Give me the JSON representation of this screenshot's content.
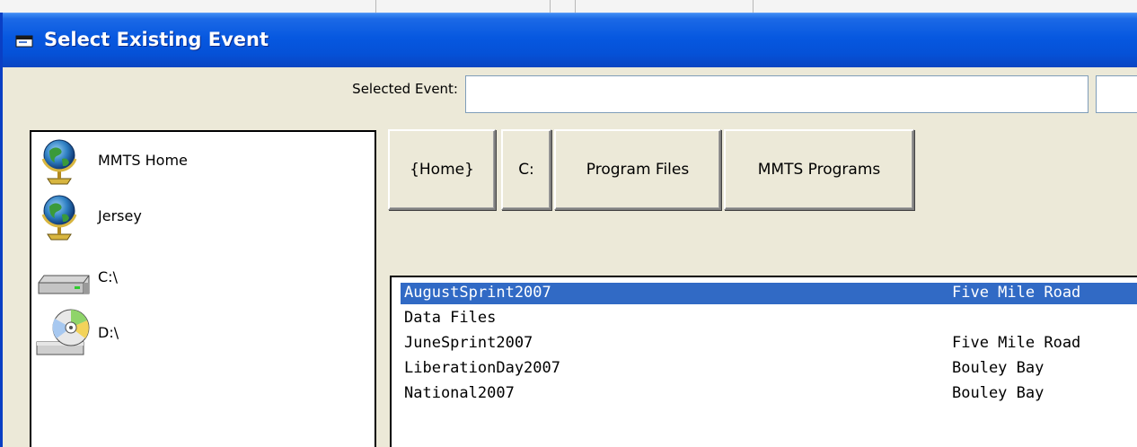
{
  "window": {
    "title": "Select Existing Event"
  },
  "selected_event": {
    "label": "Selected Event:",
    "value": ""
  },
  "drives": [
    {
      "label": "MMTS Home",
      "icon": "globe-icon"
    },
    {
      "label": "Jersey",
      "icon": "globe-icon"
    },
    {
      "label": "C:\\",
      "icon": "hard-drive-icon"
    },
    {
      "label": "D:\\",
      "icon": "cd-drive-icon"
    }
  ],
  "breadcrumbs": [
    {
      "label": "{Home}"
    },
    {
      "label": "C:"
    },
    {
      "label": "Program Files"
    },
    {
      "label": "MMTS Programs"
    }
  ],
  "events": {
    "selected_index": 0,
    "rows": [
      {
        "name": "AugustSprint2007",
        "location": "Five Mile Road"
      },
      {
        "name": "Data Files",
        "location": ""
      },
      {
        "name": "JuneSprint2007",
        "location": "Five Mile Road"
      },
      {
        "name": "LiberationDay2007",
        "location": "Bouley Bay"
      },
      {
        "name": "National2007",
        "location": "Bouley Bay"
      }
    ]
  },
  "colors": {
    "titlebar": "#0551d7",
    "selection": "#316ac5",
    "face": "#ece9d8"
  }
}
